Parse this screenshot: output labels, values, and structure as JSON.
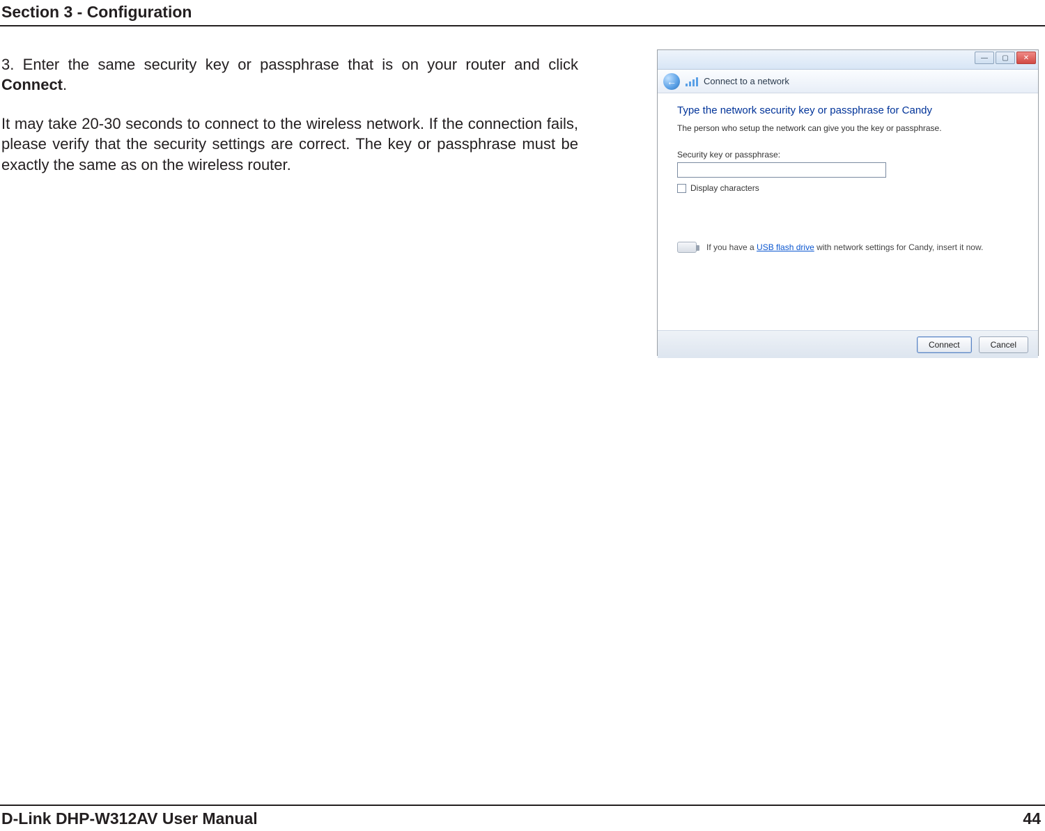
{
  "header": {
    "section": "Section 3 - Configuration"
  },
  "body": {
    "step_prefix": "3.  Enter the same security key or passphrase that is on your router and click ",
    "step_bold": "Connect",
    "step_suffix": ".",
    "para": "It may take 20-30 seconds to connect to the wireless network. If the connection fails, please verify that the security settings are correct. The key or passphrase must be exactly the same as on the wireless router."
  },
  "footer": {
    "manual": "D-Link DHP-W312AV User Manual",
    "page": "44"
  },
  "dialog": {
    "window_title": "Connect to a network",
    "heading": "Type the network security key or passphrase for Candy",
    "subtitle": "The person who setup the network can give you the key or passphrase.",
    "field_label": "Security key or passphrase:",
    "field_value": "",
    "display_chars": "Display characters",
    "usb_prefix": "If you have a ",
    "usb_link": "USB flash drive",
    "usb_suffix": " with network settings for Candy, insert it now.",
    "connect": "Connect",
    "cancel": "Cancel",
    "min": "—",
    "max": "▢",
    "close": "✕",
    "back": "←"
  }
}
